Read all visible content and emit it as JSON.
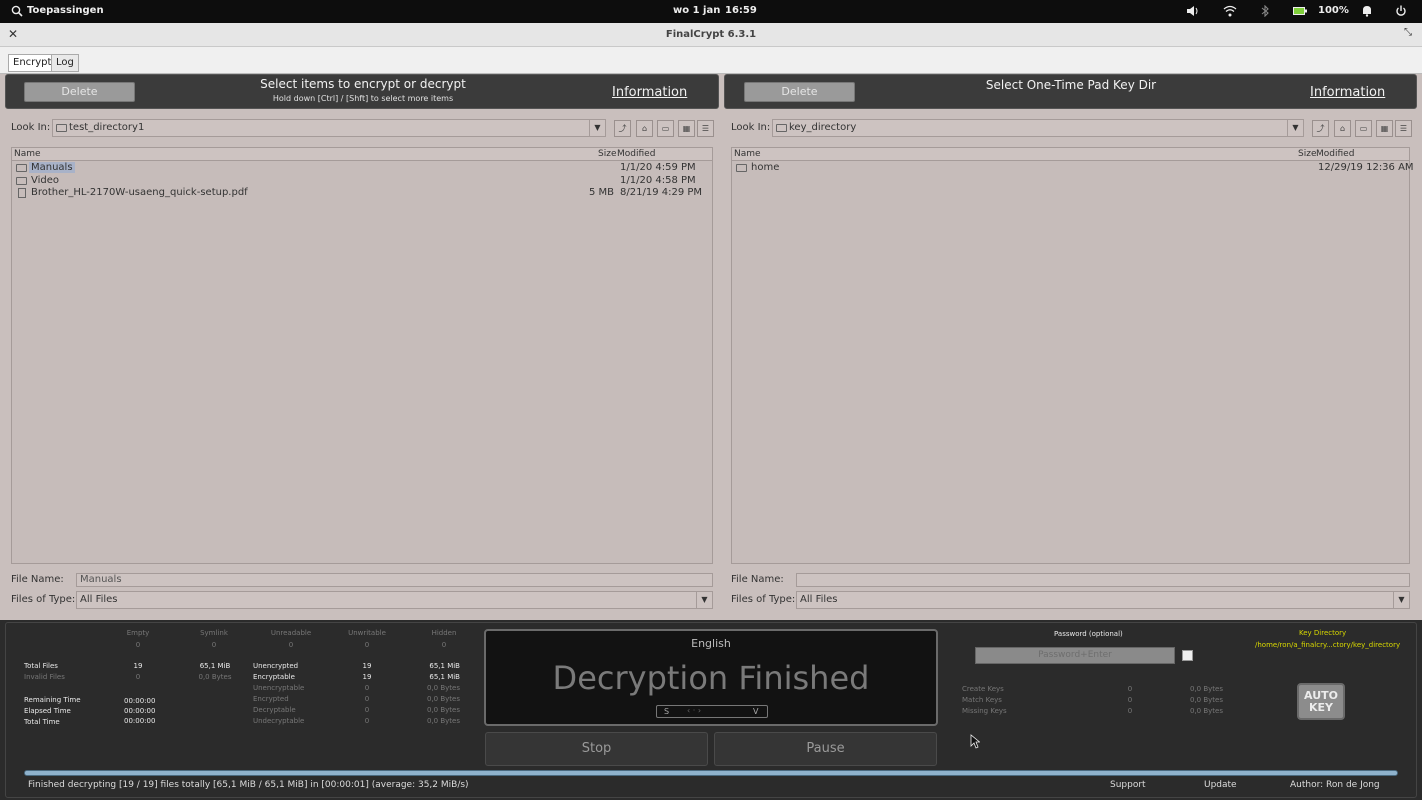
{
  "system": {
    "apps_label": "Toepassingen",
    "clock_day": "wo 1 jan",
    "clock_time": "16:59",
    "battery": "100%"
  },
  "window": {
    "title": "FinalCrypt 6.3.1"
  },
  "tabs": [
    {
      "label": "Encrypt"
    },
    {
      "label": "Log"
    }
  ],
  "left_panel": {
    "delete_label": "Delete",
    "title": "Select items to encrypt or decrypt",
    "subtitle": "Hold down [Ctrl] / [Shft] to select more items",
    "info_label": "Information",
    "look_in_label": "Look In:",
    "look_in_value": "test_directory1",
    "columns": {
      "name": "Name",
      "size": "Size",
      "modified": "Modified"
    },
    "rows": [
      {
        "name": "Manuals",
        "size": "",
        "modified": "1/1/20 4:59 PM"
      },
      {
        "name": "Video",
        "size": "",
        "modified": "1/1/20 4:58 PM"
      },
      {
        "name": "Brother_HL-2170W-usaeng_quick-setup.pdf",
        "size": "5 MB",
        "modified": "8/21/19 4:29 PM"
      }
    ],
    "file_name_label": "File Name:",
    "file_name_value": "Manuals",
    "files_of_type_label": "Files of Type:",
    "files_of_type_value": "All Files"
  },
  "right_panel": {
    "delete_label": "Delete",
    "title": "Select One-Time Pad Key Dir",
    "info_label": "Information",
    "look_in_label": "Look In:",
    "look_in_value": "key_directory",
    "columns": {
      "name": "Name",
      "size": "Size",
      "modified": "Modified"
    },
    "rows": [
      {
        "name": "home",
        "size": "",
        "modified": "12/29/19 12:36 AM"
      }
    ],
    "file_name_label": "File Name:",
    "file_name_value": "",
    "files_of_type_label": "Files of Type:",
    "files_of_type_value": "All Files"
  },
  "stats": {
    "headers": [
      "Empty",
      "Symlink",
      "Unreadable",
      "Unwritable",
      "Hidden"
    ],
    "header_values": [
      "0",
      "0",
      "0",
      "0",
      "0"
    ],
    "total_files_label": "Total Files",
    "total_files": "19",
    "total_files_bytes": "65,1 MiB",
    "invalid_files_label": "Invalid Files",
    "invalid_files": "0",
    "invalid_files_bytes": "0,0 Bytes",
    "remaining_time_label": "Remaining Time",
    "remaining_time": "00:00:00",
    "elapsed_time_label": "Elapsed Time",
    "elapsed_time": "00:00:00",
    "total_time_label": "Total Time",
    "total_time": "00:00:00",
    "rows": [
      {
        "label": "Unencrypted",
        "count": "19",
        "bytes": "65,1 MiB"
      },
      {
        "label": "Encryptable",
        "count": "19",
        "bytes": "65,1 MiB"
      },
      {
        "label": "Unencryptable",
        "count": "0",
        "bytes": "0,0 Bytes"
      },
      {
        "label": "Encrypted",
        "count": "0",
        "bytes": "0,0 Bytes"
      },
      {
        "label": "Decryptable",
        "count": "0",
        "bytes": "0,0 Bytes"
      },
      {
        "label": "Undecryptable",
        "count": "0",
        "bytes": "0,0 Bytes"
      }
    ]
  },
  "display": {
    "language": "English",
    "message": "Decryption Finished",
    "selector_s": "S",
    "selector_v": "V"
  },
  "buttons": {
    "stop": "Stop",
    "pause": "Pause"
  },
  "keys": {
    "password_label": "Password (optional)",
    "password_placeholder": "Password+Enter",
    "key_directory_label": "Key Directory",
    "key_directory_path": "/home/ron/a_finalcry...ctory/key_directory",
    "rows": [
      {
        "label": "Create Keys",
        "count": "0",
        "bytes": "0,0 Bytes"
      },
      {
        "label": "Match Keys",
        "count": "0",
        "bytes": "0,0 Bytes"
      },
      {
        "label": "Missing Keys",
        "count": "0",
        "bytes": "0,0 Bytes"
      }
    ],
    "auto_key_line1": "AUTO",
    "auto_key_line2": "KEY"
  },
  "progress": 1.0,
  "statusbar": {
    "message": "Finished decrypting [19 / 19] files totally [65,1 MiB / 65,1 MiB] in [00:00:01] (average: 35,2 MiB/s)",
    "support": "Support",
    "update": "Update",
    "author": "Author: Ron de Jong"
  }
}
